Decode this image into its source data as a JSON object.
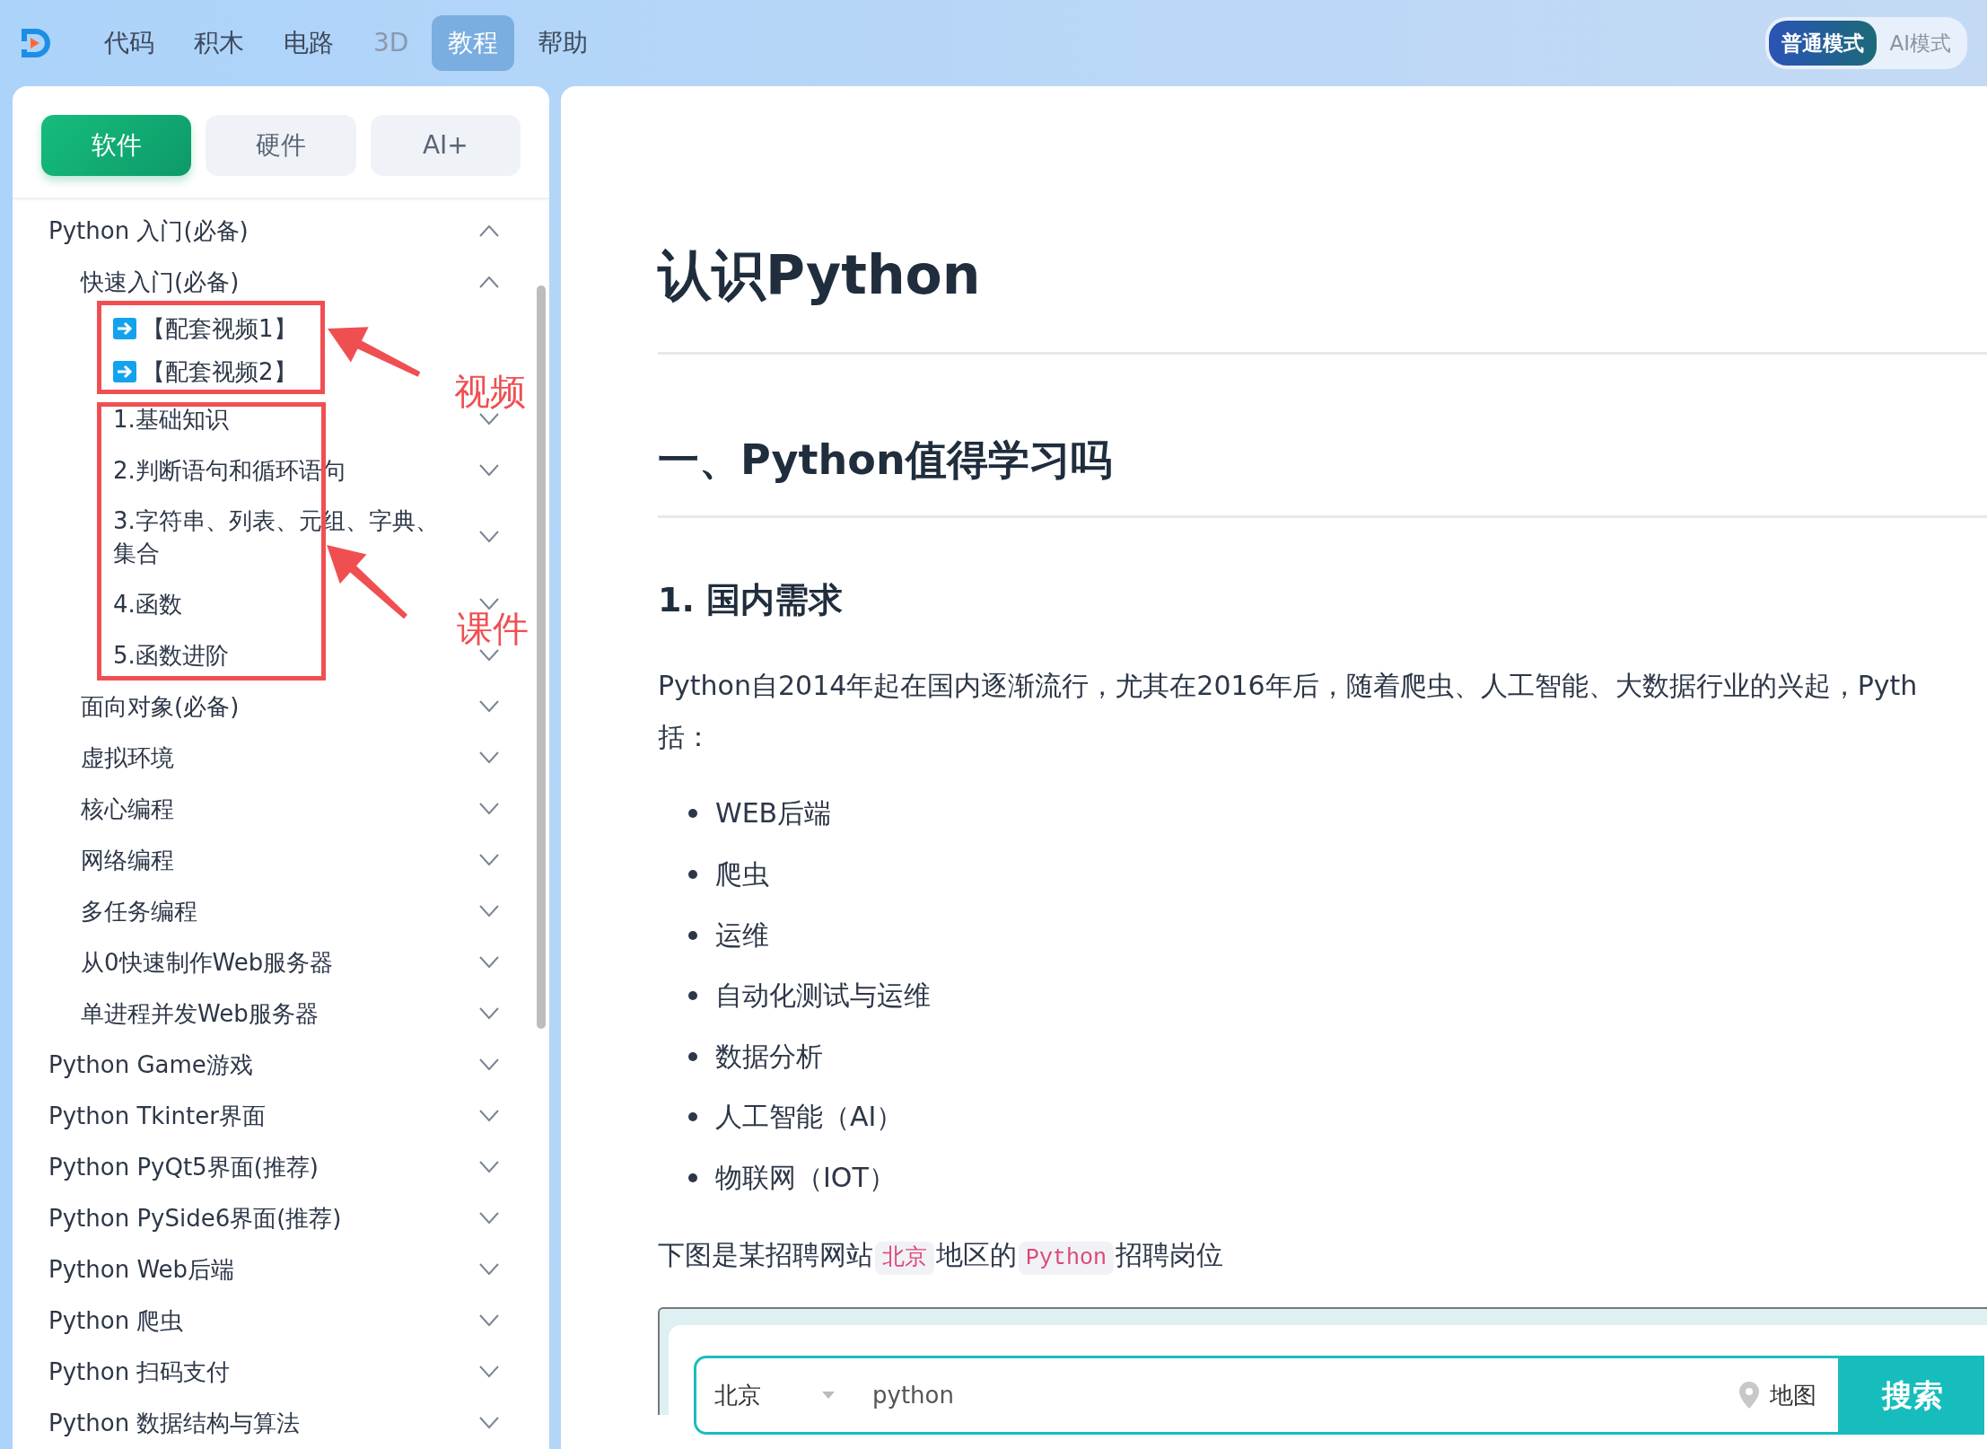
{
  "topbar": {
    "nav": [
      {
        "label": "代码",
        "selected": false,
        "disabled": false
      },
      {
        "label": "积木",
        "selected": false,
        "disabled": false
      },
      {
        "label": "电路",
        "selected": false,
        "disabled": false
      },
      {
        "label": "3D",
        "selected": false,
        "disabled": true
      },
      {
        "label": "教程",
        "selected": true,
        "disabled": false
      },
      {
        "label": "帮助",
        "selected": false,
        "disabled": false
      }
    ],
    "modes": [
      {
        "label": "普通模式",
        "selected": true
      },
      {
        "label": "AI模式",
        "selected": false
      }
    ]
  },
  "sidebar": {
    "tabs": [
      {
        "label": "软件",
        "selected": true
      },
      {
        "label": "硬件",
        "selected": false
      },
      {
        "label": "AI+",
        "selected": false
      }
    ],
    "tree": [
      {
        "label": "Python 入门(必备)",
        "expanded": true,
        "children": [
          {
            "label": "快速入门(必备)",
            "expanded": true,
            "children": [
              {
                "kind": "video",
                "label": "【配套视频1】"
              },
              {
                "kind": "video",
                "label": "【配套视频2】"
              },
              {
                "kind": "lesson",
                "label": "1.基础知识",
                "expanded": false
              },
              {
                "kind": "lesson",
                "label": "2.判断语句和循环语句",
                "expanded": false
              },
              {
                "kind": "lesson",
                "label": "3.字符串、列表、元组、字典、集合",
                "expanded": false
              },
              {
                "kind": "lesson",
                "label": "4.函数",
                "expanded": false
              },
              {
                "kind": "lesson",
                "label": "5.函数进阶",
                "expanded": false
              }
            ]
          },
          {
            "label": "面向对象(必备)",
            "expanded": false
          },
          {
            "label": "虚拟环境",
            "expanded": false
          },
          {
            "label": "核心编程",
            "expanded": false
          },
          {
            "label": "网络编程",
            "expanded": false
          },
          {
            "label": "多任务编程",
            "expanded": false
          },
          {
            "label": "从0快速制作Web服务器",
            "expanded": false
          },
          {
            "label": "单进程并发Web服务器",
            "expanded": false
          }
        ]
      },
      {
        "label": "Python Game游戏",
        "expanded": false
      },
      {
        "label": "Python Tkinter界面",
        "expanded": false
      },
      {
        "label": "Python PyQt5界面(推荐)",
        "expanded": false
      },
      {
        "label": "Python PySide6界面(推荐)",
        "expanded": false
      },
      {
        "label": "Python Web后端",
        "expanded": false
      },
      {
        "label": "Python 爬虫",
        "expanded": false
      },
      {
        "label": "Python 扫码支付",
        "expanded": false
      },
      {
        "label": "Python 数据结构与算法",
        "expanded": false
      }
    ]
  },
  "annotations": [
    {
      "label": "视频"
    },
    {
      "label": "课件"
    }
  ],
  "article": {
    "title": "认识Python",
    "section": "一、Python值得学习吗",
    "subsection": "1. 国内需求",
    "paragraph": [
      "Python自2014年起在国内逐渐流行，尤其在2016年后，随着爬虫、人工智能、大数据行业的兴起，Pyth",
      "括："
    ],
    "bullets": [
      "WEB后端",
      "爬虫",
      "运维",
      "自动化测试与运维",
      "数据分析",
      "人工智能（AI）",
      "物联网（IOT）"
    ],
    "caption": [
      {
        "kind": "text",
        "text": "下图是某招聘网站"
      },
      {
        "kind": "code",
        "text": "北京"
      },
      {
        "kind": "text",
        "text": "地区的"
      },
      {
        "kind": "code",
        "text": "Python"
      },
      {
        "kind": "text",
        "text": "招聘岗位"
      }
    ],
    "figure": {
      "city": "北京",
      "query": "python",
      "map": "地图",
      "search": "搜索"
    }
  }
}
